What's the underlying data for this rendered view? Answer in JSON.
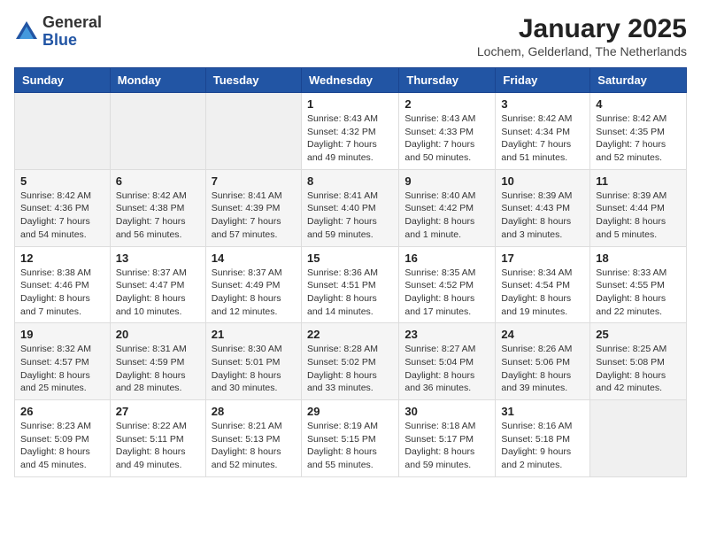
{
  "logo": {
    "general": "General",
    "blue": "Blue"
  },
  "title": "January 2025",
  "location": "Lochem, Gelderland, The Netherlands",
  "weekdays": [
    "Sunday",
    "Monday",
    "Tuesday",
    "Wednesday",
    "Thursday",
    "Friday",
    "Saturday"
  ],
  "weeks": [
    [
      {
        "day": "",
        "info": ""
      },
      {
        "day": "",
        "info": ""
      },
      {
        "day": "",
        "info": ""
      },
      {
        "day": "1",
        "info": "Sunrise: 8:43 AM\nSunset: 4:32 PM\nDaylight: 7 hours\nand 49 minutes."
      },
      {
        "day": "2",
        "info": "Sunrise: 8:43 AM\nSunset: 4:33 PM\nDaylight: 7 hours\nand 50 minutes."
      },
      {
        "day": "3",
        "info": "Sunrise: 8:42 AM\nSunset: 4:34 PM\nDaylight: 7 hours\nand 51 minutes."
      },
      {
        "day": "4",
        "info": "Sunrise: 8:42 AM\nSunset: 4:35 PM\nDaylight: 7 hours\nand 52 minutes."
      }
    ],
    [
      {
        "day": "5",
        "info": "Sunrise: 8:42 AM\nSunset: 4:36 PM\nDaylight: 7 hours\nand 54 minutes."
      },
      {
        "day": "6",
        "info": "Sunrise: 8:42 AM\nSunset: 4:38 PM\nDaylight: 7 hours\nand 56 minutes."
      },
      {
        "day": "7",
        "info": "Sunrise: 8:41 AM\nSunset: 4:39 PM\nDaylight: 7 hours\nand 57 minutes."
      },
      {
        "day": "8",
        "info": "Sunrise: 8:41 AM\nSunset: 4:40 PM\nDaylight: 7 hours\nand 59 minutes."
      },
      {
        "day": "9",
        "info": "Sunrise: 8:40 AM\nSunset: 4:42 PM\nDaylight: 8 hours\nand 1 minute."
      },
      {
        "day": "10",
        "info": "Sunrise: 8:39 AM\nSunset: 4:43 PM\nDaylight: 8 hours\nand 3 minutes."
      },
      {
        "day": "11",
        "info": "Sunrise: 8:39 AM\nSunset: 4:44 PM\nDaylight: 8 hours\nand 5 minutes."
      }
    ],
    [
      {
        "day": "12",
        "info": "Sunrise: 8:38 AM\nSunset: 4:46 PM\nDaylight: 8 hours\nand 7 minutes."
      },
      {
        "day": "13",
        "info": "Sunrise: 8:37 AM\nSunset: 4:47 PM\nDaylight: 8 hours\nand 10 minutes."
      },
      {
        "day": "14",
        "info": "Sunrise: 8:37 AM\nSunset: 4:49 PM\nDaylight: 8 hours\nand 12 minutes."
      },
      {
        "day": "15",
        "info": "Sunrise: 8:36 AM\nSunset: 4:51 PM\nDaylight: 8 hours\nand 14 minutes."
      },
      {
        "day": "16",
        "info": "Sunrise: 8:35 AM\nSunset: 4:52 PM\nDaylight: 8 hours\nand 17 minutes."
      },
      {
        "day": "17",
        "info": "Sunrise: 8:34 AM\nSunset: 4:54 PM\nDaylight: 8 hours\nand 19 minutes."
      },
      {
        "day": "18",
        "info": "Sunrise: 8:33 AM\nSunset: 4:55 PM\nDaylight: 8 hours\nand 22 minutes."
      }
    ],
    [
      {
        "day": "19",
        "info": "Sunrise: 8:32 AM\nSunset: 4:57 PM\nDaylight: 8 hours\nand 25 minutes."
      },
      {
        "day": "20",
        "info": "Sunrise: 8:31 AM\nSunset: 4:59 PM\nDaylight: 8 hours\nand 28 minutes."
      },
      {
        "day": "21",
        "info": "Sunrise: 8:30 AM\nSunset: 5:01 PM\nDaylight: 8 hours\nand 30 minutes."
      },
      {
        "day": "22",
        "info": "Sunrise: 8:28 AM\nSunset: 5:02 PM\nDaylight: 8 hours\nand 33 minutes."
      },
      {
        "day": "23",
        "info": "Sunrise: 8:27 AM\nSunset: 5:04 PM\nDaylight: 8 hours\nand 36 minutes."
      },
      {
        "day": "24",
        "info": "Sunrise: 8:26 AM\nSunset: 5:06 PM\nDaylight: 8 hours\nand 39 minutes."
      },
      {
        "day": "25",
        "info": "Sunrise: 8:25 AM\nSunset: 5:08 PM\nDaylight: 8 hours\nand 42 minutes."
      }
    ],
    [
      {
        "day": "26",
        "info": "Sunrise: 8:23 AM\nSunset: 5:09 PM\nDaylight: 8 hours\nand 45 minutes."
      },
      {
        "day": "27",
        "info": "Sunrise: 8:22 AM\nSunset: 5:11 PM\nDaylight: 8 hours\nand 49 minutes."
      },
      {
        "day": "28",
        "info": "Sunrise: 8:21 AM\nSunset: 5:13 PM\nDaylight: 8 hours\nand 52 minutes."
      },
      {
        "day": "29",
        "info": "Sunrise: 8:19 AM\nSunset: 5:15 PM\nDaylight: 8 hours\nand 55 minutes."
      },
      {
        "day": "30",
        "info": "Sunrise: 8:18 AM\nSunset: 5:17 PM\nDaylight: 8 hours\nand 59 minutes."
      },
      {
        "day": "31",
        "info": "Sunrise: 8:16 AM\nSunset: 5:18 PM\nDaylight: 9 hours\nand 2 minutes."
      },
      {
        "day": "",
        "info": ""
      }
    ]
  ]
}
